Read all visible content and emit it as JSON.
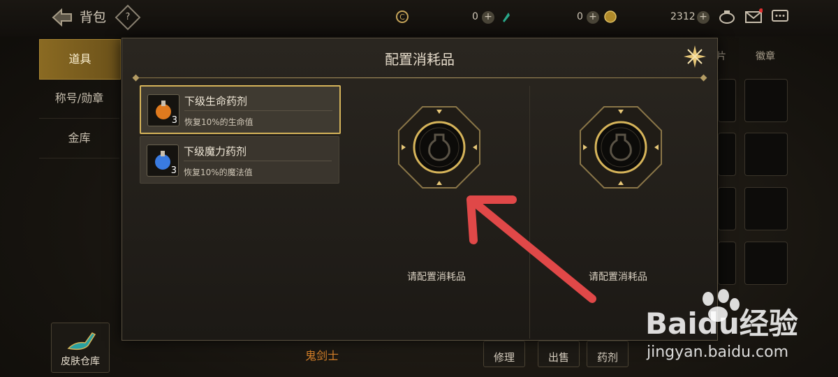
{
  "header": {
    "title": "背包",
    "help": "?"
  },
  "currencies": [
    {
      "icon": "gold-coin-icon",
      "value": "0"
    },
    {
      "icon": "gem-icon",
      "value": "0"
    },
    {
      "icon": "medal-icon",
      "value": "2312"
    }
  ],
  "tabs": [
    "道具",
    "称号/勋章",
    "金库"
  ],
  "right_tabs": [
    "片",
    "徽章"
  ],
  "bottom": {
    "skin_label": "皮肤仓库",
    "char_name": "鬼剑士",
    "repair": "修理",
    "sell": "出售",
    "potion": "药剂"
  },
  "modal": {
    "title": "配置消耗品",
    "items": [
      {
        "name": "下级生命药剂",
        "desc": "恢复10%的生命值",
        "count": "3",
        "color": "#e07a1e"
      },
      {
        "name": "下级魔力药剂",
        "desc": "恢复10%的魔法值",
        "count": "3",
        "color": "#3a7be0"
      }
    ],
    "slots": [
      {
        "label": "请配置消耗品"
      },
      {
        "label": "请配置消耗品"
      }
    ]
  },
  "watermark": {
    "brand": "Baidu经验",
    "url": "jingyan.baidu.com"
  }
}
